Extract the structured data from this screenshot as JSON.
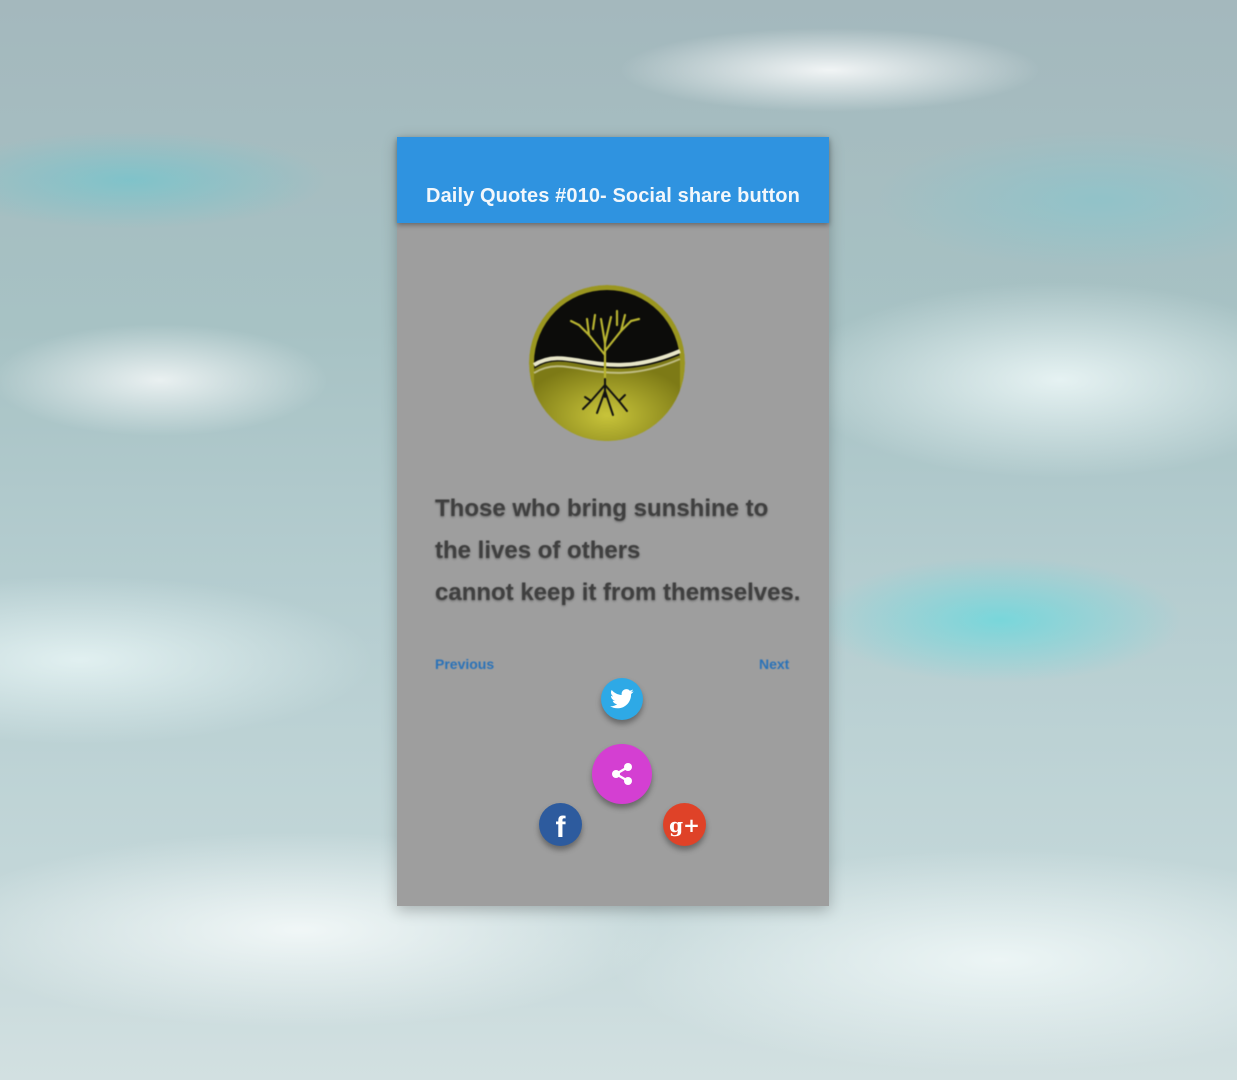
{
  "app_bar": {
    "title": "Daily Quotes #010- Social share button",
    "color": "#2f93e0"
  },
  "logo": {
    "icon": "tree-of-life-logo",
    "colors": [
      "#000000",
      "#a9a523"
    ]
  },
  "quote": {
    "lines": [
      "Those who bring sunshine to",
      "the lives of others",
      "cannot keep it from themselves."
    ]
  },
  "navigation": {
    "previous_label": "Previous",
    "next_label": "Next"
  },
  "share": {
    "main_icon": "share-icon",
    "main_color": "#d43fd2",
    "buttons": [
      {
        "icon": "twitter-icon",
        "color": "#2ea9e6"
      },
      {
        "icon": "facebook-icon",
        "color": "#2d5b9e",
        "glyph": "f"
      },
      {
        "icon": "google-plus-icon",
        "color": "#df4228",
        "glyph": "g+"
      }
    ]
  }
}
